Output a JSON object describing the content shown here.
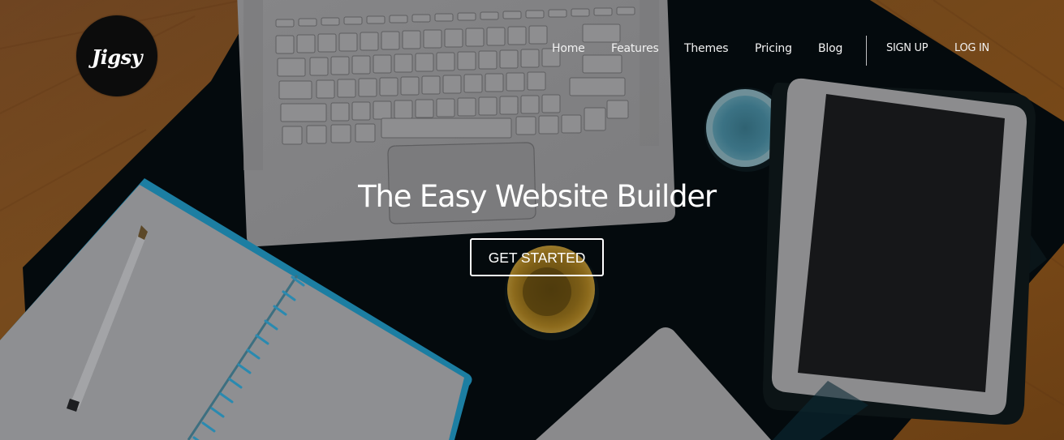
{
  "brand": {
    "logo_text": "Jigsy"
  },
  "nav": {
    "items": [
      {
        "label": "Home"
      },
      {
        "label": "Features"
      },
      {
        "label": "Themes"
      },
      {
        "label": "Pricing"
      },
      {
        "label": "Blog"
      }
    ],
    "auth": {
      "signup_label": "SIGN UP",
      "login_label": "LOG IN"
    }
  },
  "hero": {
    "headline": "The Easy Website Builder",
    "cta_label": "GET STARTED",
    "background_description": "Overhead photo of a desk: laptop keyboard, open spiral notebook with pen, tablet, two small cups, on a dark desk mat over a wooden table",
    "colors": {
      "wood": "#7a4a1c",
      "desk_mat": "#040a0c",
      "device_silver": "#8d8d8f",
      "notebook_accent": "#1d7fa0",
      "overlay_text": "#ffffff"
    }
  }
}
